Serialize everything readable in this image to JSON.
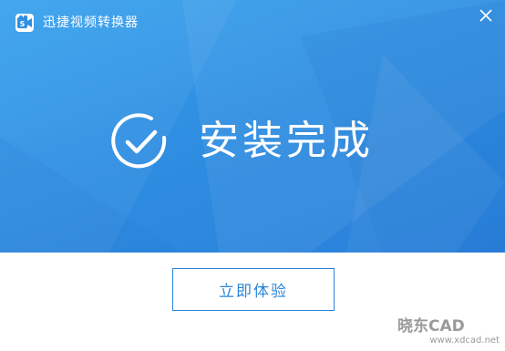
{
  "app": {
    "title": "迅捷视频转换器",
    "icon": "app-logo-icon",
    "close_icon": "close-icon"
  },
  "status": {
    "icon": "check-circle-icon",
    "message": "安装完成"
  },
  "actions": {
    "primary_label": "立即体验"
  },
  "watermark": {
    "brand": "晓东CAD",
    "url": "www.xdcad.net"
  },
  "colors": {
    "hero_background": "#2f8fe2",
    "accent": "#2a84db",
    "text_on_hero": "#ffffff"
  }
}
